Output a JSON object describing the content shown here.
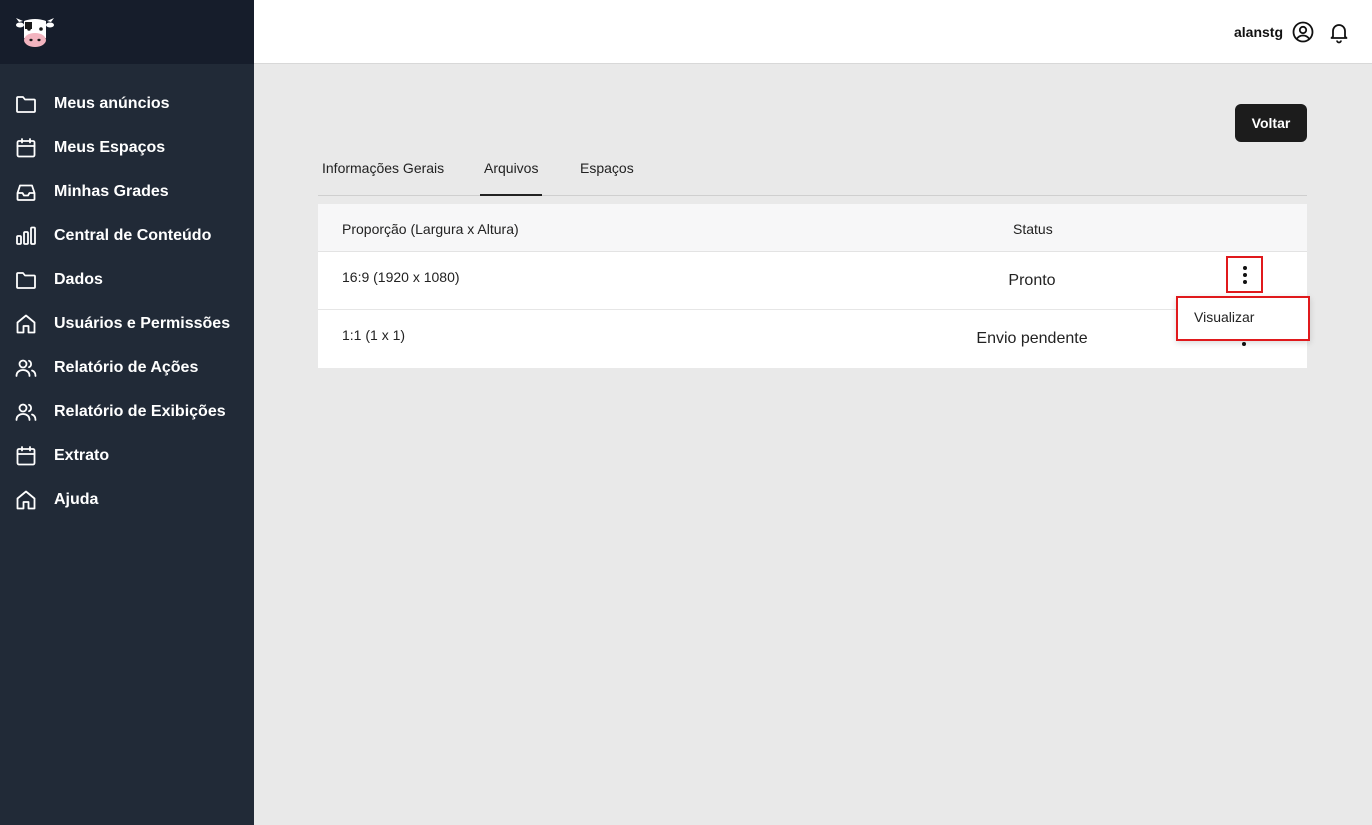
{
  "sidebar": {
    "logo": "cow-logo",
    "items": [
      {
        "label": "Meus anúncios",
        "icon": "folder-icon"
      },
      {
        "label": "Meus Espaços",
        "icon": "calendar-icon"
      },
      {
        "label": "Minhas Grades",
        "icon": "inbox-icon"
      },
      {
        "label": "Central de Conteúdo",
        "icon": "bar-chart-icon"
      },
      {
        "label": "Dados",
        "icon": "folder-icon"
      },
      {
        "label": "Usuários e Permissões",
        "icon": "home-icon"
      },
      {
        "label": "Relatório de Ações",
        "icon": "users-icon"
      },
      {
        "label": "Relatório de Exibições",
        "icon": "users-icon"
      },
      {
        "label": "Extrato",
        "icon": "calendar-icon"
      },
      {
        "label": "Ajuda",
        "icon": "home-icon"
      }
    ]
  },
  "header": {
    "username": "alanstg",
    "user_icon": "user-circle-icon",
    "bell_icon": "bell-icon"
  },
  "actions": {
    "back_label": "Voltar"
  },
  "tabs": [
    {
      "label": "Informações Gerais",
      "active": false
    },
    {
      "label": "Arquivos",
      "active": true
    },
    {
      "label": "Espaços",
      "active": false
    }
  ],
  "table": {
    "columns": [
      "Proporção (Largura x Altura)",
      "Status"
    ],
    "rows": [
      {
        "proportion": "16:9 (1920 x 1080)",
        "status": "Pronto"
      },
      {
        "proportion": "1:1 (1 x 1)",
        "status": "Envio pendente"
      }
    ]
  },
  "context_menu": {
    "items": [
      "Visualizar"
    ]
  },
  "colors": {
    "sidebar_bg": "#212a37",
    "logo_bar_bg": "#161d2b",
    "highlight": "#e0191c",
    "button_bg": "#1c1c1c"
  }
}
